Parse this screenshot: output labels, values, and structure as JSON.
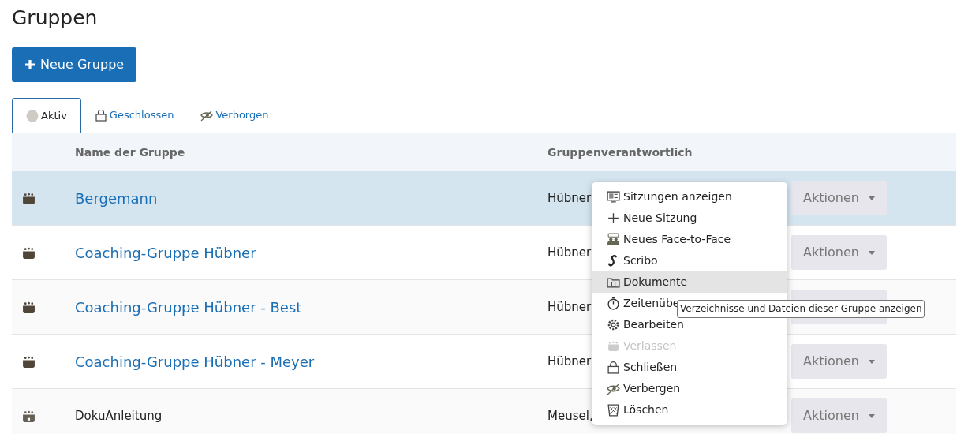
{
  "page_title": "Gruppen",
  "new_button": {
    "label": "Neue Gruppe"
  },
  "tabs": [
    {
      "label": "Aktiv",
      "kind": "active",
      "selected": true
    },
    {
      "label": "Geschlossen",
      "kind": "closed",
      "selected": false
    },
    {
      "label": "Verborgen",
      "kind": "hidden",
      "selected": false
    }
  ],
  "table": {
    "columns": [
      "Name der Gruppe",
      "Gruppenverantwortlich"
    ],
    "rows": [
      {
        "kind": "link",
        "name": "Bergemann",
        "responsible": "Hübner,",
        "action": "Aktionen",
        "selected": true
      },
      {
        "kind": "link",
        "name": "Coaching-Gruppe Hübner",
        "responsible": "Hübner,",
        "action": "Aktionen",
        "selected": false
      },
      {
        "kind": "link",
        "name": "Coaching-Gruppe Hübner - Best",
        "responsible": "Hübner,",
        "selected": false
      },
      {
        "kind": "link",
        "name": "Coaching-Gruppe Hübner - Meyer",
        "responsible": "Hübner,",
        "action": "Aktionen",
        "selected": false
      },
      {
        "kind": "plain",
        "name": "DokuAnleitung",
        "responsible": "Meusel,",
        "action": "Aktionen",
        "selected": false
      }
    ]
  },
  "menu": {
    "items": [
      {
        "kind": "monitor",
        "label": "Sitzungen anzeigen",
        "selected": false,
        "disabled": false
      },
      {
        "kind": "plus",
        "label": "Neue Sitzung",
        "selected": false,
        "disabled": false
      },
      {
        "kind": "people",
        "label": "Neues Face-to-Face",
        "selected": false,
        "disabled": false
      },
      {
        "kind": "s",
        "label": "Scribo",
        "selected": false,
        "disabled": false
      },
      {
        "kind": "folder",
        "label": "Dokumente",
        "selected": true,
        "disabled": false
      },
      {
        "kind": "stopwatch",
        "label": "Zeitenübe",
        "selected": false,
        "disabled": false
      },
      {
        "kind": "gear",
        "label": "Bearbeiten",
        "selected": false,
        "disabled": false
      },
      {
        "kind": "group",
        "label": "Verlassen",
        "selected": false,
        "disabled": true
      },
      {
        "kind": "lock",
        "label": "Schließen",
        "selected": false,
        "disabled": false
      },
      {
        "kind": "eye",
        "label": "Verbergen",
        "selected": false,
        "disabled": false
      },
      {
        "kind": "trash",
        "label": "Löschen",
        "selected": false,
        "disabled": false
      }
    ]
  },
  "tooltip": "Verzeichnisse und Dateien dieser Gruppe anzeigen"
}
